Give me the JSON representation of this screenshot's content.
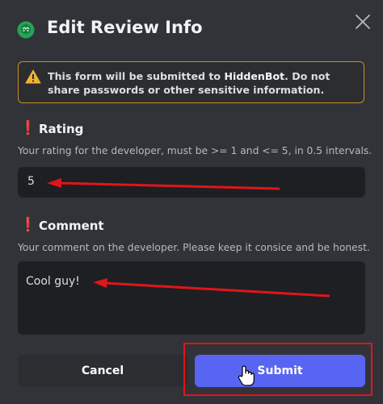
{
  "dialog": {
    "title": "Edit Review Info",
    "app_icon": "green-bot-avatar-icon",
    "close_icon": "close-icon"
  },
  "notice": {
    "icon": "warning-triangle-icon",
    "text_before": "This form will be submitted to ",
    "target": "HiddenBot",
    "text_after": ". Do not share passwords or other sensitive information."
  },
  "fields": {
    "rating": {
      "required_mark": "❗",
      "label": "Rating",
      "description": "Your rating for the developer, must be >= 1 and <= 5, in 0.5 intervals.",
      "value": "5"
    },
    "comment": {
      "required_mark": "❗",
      "label": "Comment",
      "description": "Your comment on the developer. Please keep it consice and be honest.",
      "value": "Cool guy!"
    }
  },
  "buttons": {
    "cancel": "Cancel",
    "submit": "Submit"
  },
  "colors": {
    "background": "#313338",
    "input_bg": "#1e1f22",
    "accent": "#5865f2",
    "warning_border": "#c78f27",
    "annotation_red": "#e0151b"
  }
}
